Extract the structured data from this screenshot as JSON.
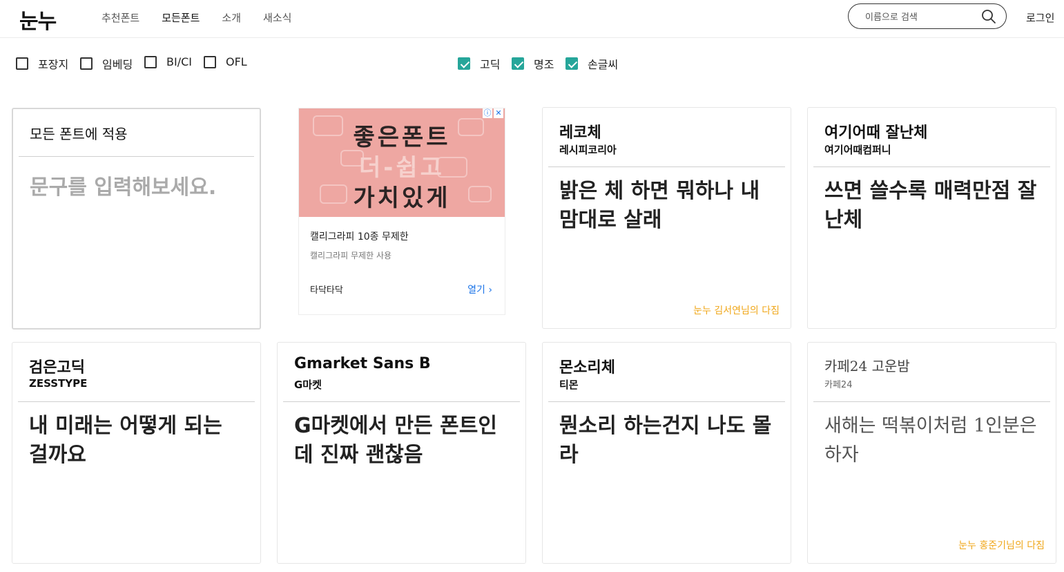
{
  "header": {
    "logo": "눈누",
    "nav": [
      "추천폰트",
      "모든폰트",
      "소개",
      "새소식"
    ],
    "search_placeholder": "이름으로 검색",
    "login": "로그인"
  },
  "filters": {
    "license": [
      {
        "label": "포장지",
        "checked": false
      },
      {
        "label": "임베딩",
        "checked": false
      },
      {
        "label": "BI/CI",
        "checked": false
      },
      {
        "label": "OFL",
        "checked": false
      }
    ],
    "style": [
      {
        "label": "고딕",
        "checked": true
      },
      {
        "label": "명조",
        "checked": true
      },
      {
        "label": "손글씨",
        "checked": true
      }
    ],
    "accent_color": "#26a69a"
  },
  "input_card": {
    "title": "모든 폰트에 적용",
    "placeholder": "문구를 입력해보세요."
  },
  "ad": {
    "banner_line1": "좋은폰트",
    "banner_line2": "더-쉽고",
    "banner_line3": "가치있게",
    "title": "캘리그라피 10종 무제한",
    "desc": "캘리그라피 무제한 사용",
    "brand": "타닥타닥",
    "open": "열기"
  },
  "fonts": [
    {
      "title": "레코체",
      "maker": "레시피코리아",
      "sample": "밝은 체 하면 뭐하나 내 맘대로 살래",
      "credit": "눈누 김서연님의 다짐"
    },
    {
      "title": "여기어때 잘난체",
      "maker": "여기어때컴퍼니",
      "sample": "쓰면 쓸수록 매력만점 잘난체",
      "credit": ""
    },
    {
      "title": "검은고딕",
      "maker": "ZESSTYPE",
      "sample": "내 미래는 어떻게 되는 걸까요",
      "credit": ""
    },
    {
      "title": "Gmarket Sans B",
      "maker": "G마켓",
      "sample": "G마켓에서 만든 폰트인데 진짜 괜찮음",
      "credit": ""
    },
    {
      "title": "몬소리체",
      "maker": "티몬",
      "sample": "뭔소리 하는건지 나도 몰라",
      "credit": ""
    },
    {
      "title": "카페24 고운밤",
      "maker": "카페24",
      "sample": "새해는 떡볶이처럼 1인분은 하자",
      "credit": "눈누 홍준기님의 다짐"
    }
  ]
}
